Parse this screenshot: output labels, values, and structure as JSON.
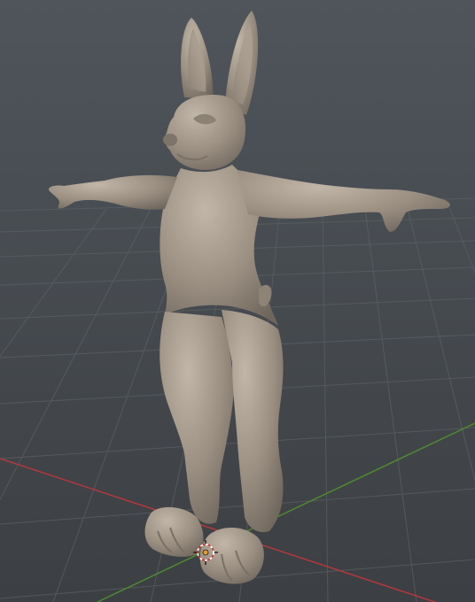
{
  "viewport": {
    "background_top": "#4f555b",
    "background_bottom": "#3b3e42",
    "grid_line_color": "#5a5f63",
    "axis_x_color": "#b5373d",
    "axis_y_color": "#4f8a2d",
    "model_color": "#9a8e80",
    "model_shadow_color": "#6f655a",
    "model_highlight_color": "#c4b8aa",
    "origin_marker_color": "#e89a2a",
    "icons": [
      "3d-cursor-icon",
      "origin-marker-icon"
    ]
  }
}
